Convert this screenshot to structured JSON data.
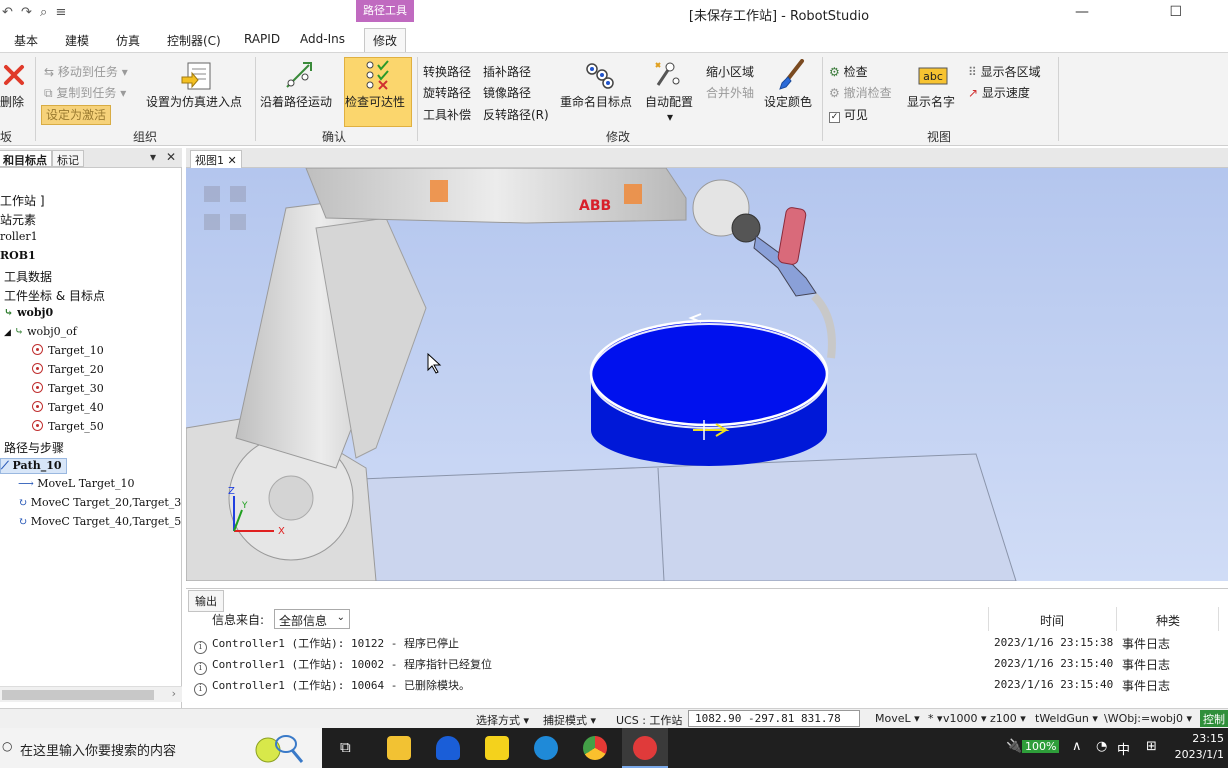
{
  "window": {
    "title": "[未保存工作站] - RobotStudio",
    "context_tab": "路径工具",
    "quick_access": "↶ ↷ ⌕ ≡",
    "minimize": "—",
    "restore": "☐"
  },
  "tabs": [
    "基本",
    "建模",
    "仿真",
    "控制器(C)",
    "RAPID",
    "Add-Ins",
    "修改"
  ],
  "ribbon": {
    "delete_label": "删除",
    "group_partial": "坂",
    "move_to_task": "移动到任务",
    "copy_to_task": "复制到任务",
    "set_active": "设定为激活",
    "set_sim_entry": "设置为仿真进入点",
    "group_organize": "组织",
    "move_along_path": "沿着路径运动",
    "check_reachability": "检查可达性",
    "group_confirm": "确认",
    "convert_path": "转换路径",
    "interpolate_path": "插补路径",
    "rotate_path": "旋转路径",
    "mirror_path": "镜像路径",
    "tool_compensation": "工具补偿",
    "reverse_path": "反转路径(R)",
    "rename_targets": "重命名目标点",
    "auto_config": "自动配置",
    "shrink_zone": "缩小区域",
    "merge_external_axes": "合并外轴",
    "set_color": "设定颜色",
    "group_modify": "修改",
    "inspect": "检查",
    "cancel_inspect": "撤消检查",
    "visible": "可见",
    "show_names": "显示名字",
    "show_zones": "显示各区域",
    "show_speed": "显示速度",
    "group_view": "视图"
  },
  "left_panel": {
    "tab_paths": "和目标点",
    "tab_tags": "标记",
    "pin": "▾",
    "close": "✕",
    "tree": [
      {
        "label": "工作站 ]",
        "kind": "text"
      },
      {
        "label": "站元素",
        "kind": "text"
      },
      {
        "label": "roller1",
        "kind": "mono"
      },
      {
        "label": "ROB1",
        "kind": "bold"
      },
      {
        "label": "工具数据",
        "kind": "text"
      },
      {
        "label": "工件坐标 & 目标点",
        "kind": "text"
      },
      {
        "label": "wobj0",
        "kind": "bold-mono"
      },
      {
        "label": "wobj0_of",
        "kind": "mono"
      },
      {
        "label": "Target_10",
        "kind": "target"
      },
      {
        "label": "Target_20",
        "kind": "target"
      },
      {
        "label": "Target_30",
        "kind": "target"
      },
      {
        "label": "Target_40",
        "kind": "target"
      },
      {
        "label": "Target_50",
        "kind": "target"
      },
      {
        "label": "路径与步骤",
        "kind": "text"
      },
      {
        "label": "Path_10",
        "kind": "path"
      },
      {
        "label": "MoveL Target_10",
        "kind": "movel"
      },
      {
        "label": "MoveC Target_20,Target_3",
        "kind": "movec"
      },
      {
        "label": "MoveC Target_40,Target_5",
        "kind": "movec"
      }
    ]
  },
  "viewport": {
    "tab_label": "视图1",
    "tab_close": "✕",
    "brand": "ABB",
    "axis_z": "Z",
    "axis_x": "X",
    "axis_y": "Y"
  },
  "output": {
    "tab_label": "输出",
    "filter_label": "信息来自:",
    "filter_value": "全部信息",
    "col_time": "时间",
    "col_type": "种类",
    "info_glyph": "i",
    "rows": [
      {
        "message": "Controller1 (工作站): 10122 - 程序已停止",
        "time": "2023/1/16 23:15:38",
        "type": "事件日志"
      },
      {
        "message": "Controller1 (工作站): 10002 - 程序指针已经复位",
        "time": "2023/1/16 23:15:40",
        "type": "事件日志"
      },
      {
        "message": "Controller1 (工作站): 10064 - 已删除模块。",
        "time": "2023/1/16 23:15:40",
        "type": "事件日志"
      }
    ]
  },
  "statusbar": {
    "select_mode": "选择方式 ▾",
    "snap_mode": "捕捉模式 ▾",
    "ucs": "UCS : 工作站",
    "coords": "1082.90  -297.81  831.78",
    "move_type": "MoveL ▾",
    "star": "* ▾",
    "speed": "v1000 ▾",
    "zone": "z100 ▾",
    "tool": "tWeldGun ▾",
    "wobj": "\\WObj:=wobj0 ▾",
    "control": "控制"
  },
  "taskbar": {
    "search_placeholder": "在这里输入你要搜索的内容",
    "battery": "100%",
    "ime": "中",
    "time": "23:15",
    "date": "2023/1/1",
    "tray_up": "∧",
    "tray_grid": "⊞"
  }
}
